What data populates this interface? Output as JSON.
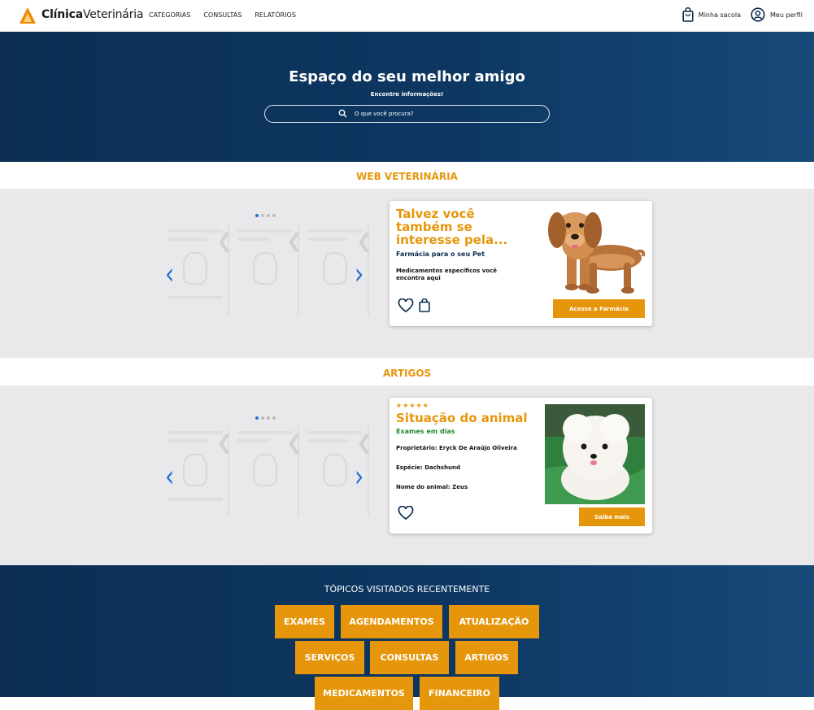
{
  "header": {
    "brand_bold": "Clínica",
    "brand_rest": "Veterinária",
    "nav": [
      "CATEGORIAS",
      "CONSULTAS",
      "RELATÓRIOS"
    ],
    "bag_label": "Minha sacola",
    "profile_label": "Meu perfil"
  },
  "hero": {
    "title": "Espaço do seu melhor amigo",
    "subtitle": "Encontre informações!",
    "search_placeholder": "O que você procura?"
  },
  "section1": {
    "title": "WEB VETERINÁRIA",
    "card": {
      "title": "Talvez você também se interesse pela...",
      "subtitle": "Farmácia para o seu Pet",
      "text": "Medicamentos específicos você encontra aqui",
      "button": "Acesse a Farmácia"
    }
  },
  "section2": {
    "title": "ARTIGOS",
    "card": {
      "stars": "★★★★★",
      "title": "Situação do animal",
      "subtitle": "Exames em dias",
      "owner": "Proprietário: Eryck De Araújo Oliveira",
      "species": "Espécie: Dachshund",
      "animal_name": "Nome do animal: Zeus",
      "button": "Saiba mais"
    }
  },
  "footer": {
    "title": "TÓPICOS VISITADOS RECENTEMENTE",
    "tags": [
      "EXAMES",
      "AGENDAMENTOS",
      "ATUALIZAÇÃO",
      "SERVIÇOS",
      "CONSULTAS",
      "ARTIGOS",
      "MEDICAMENTOS",
      "FINANCEIRO"
    ]
  },
  "colors": {
    "accent": "#e6960a",
    "navy": "#0d3762",
    "link_blue": "#1e6fd9",
    "band_gray": "#e9e9eb",
    "subtitle_green": "#1e8a2a"
  }
}
